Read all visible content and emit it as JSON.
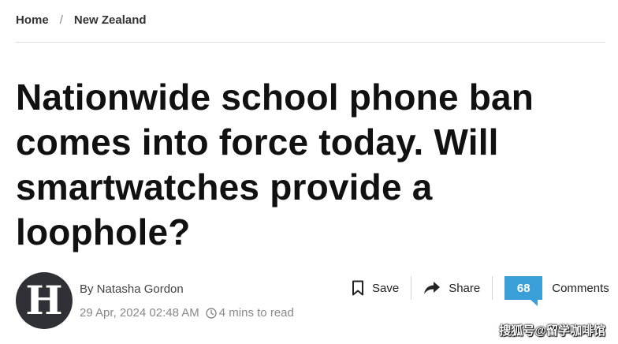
{
  "breadcrumb": {
    "home": "Home",
    "separator": "/",
    "section": "New Zealand"
  },
  "article": {
    "title": "Nationwide school phone ban comes into force today. Will smartwatches provide a loophole?",
    "byline": "By Natasha Gordon",
    "date": "29 Apr, 2024 02:48 AM",
    "read_time": "4 mins to read"
  },
  "actions": {
    "save_label": "Save",
    "share_label": "Share",
    "comments_count": "68",
    "comments_label": "Comments"
  },
  "watermark": "搜狐号@留学咖啡馆",
  "icons": {
    "avatar": "herald-h-logo",
    "save": "bookmark-icon",
    "share": "share-arrow-icon",
    "time": "clock-icon"
  },
  "colors": {
    "accent": "#3a9fd8",
    "avatar_bg": "#2f3136"
  }
}
